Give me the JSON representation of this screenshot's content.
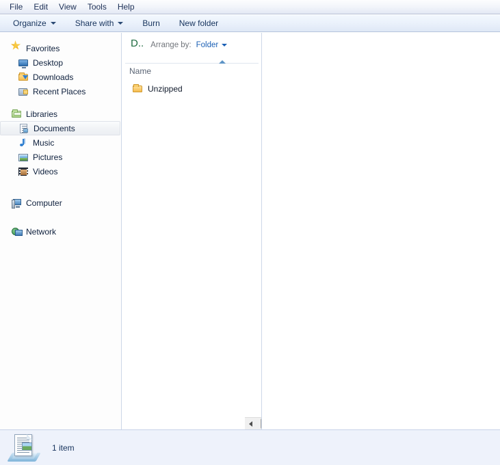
{
  "menubar": {
    "items": [
      {
        "label": "File",
        "name": "menu-file"
      },
      {
        "label": "Edit",
        "name": "menu-edit"
      },
      {
        "label": "View",
        "name": "menu-view"
      },
      {
        "label": "Tools",
        "name": "menu-tools"
      },
      {
        "label": "Help",
        "name": "menu-help"
      }
    ]
  },
  "toolbar": {
    "organize_label": "Organize",
    "share_with_label": "Share with",
    "burn_label": "Burn",
    "new_folder_label": "New folder"
  },
  "sidebar": {
    "groups": [
      {
        "label": "Favorites",
        "icon": "star-icon",
        "children": [
          {
            "label": "Desktop",
            "icon": "monitor-icon"
          },
          {
            "label": "Downloads",
            "icon": "downloads-folder-icon"
          },
          {
            "label": "Recent Places",
            "icon": "recent-places-icon"
          }
        ]
      },
      {
        "label": "Libraries",
        "icon": "libraries-icon",
        "children": [
          {
            "label": "Documents",
            "icon": "document-icon",
            "selected": true
          },
          {
            "label": "Music",
            "icon": "music-note-icon"
          },
          {
            "label": "Pictures",
            "icon": "picture-icon"
          },
          {
            "label": "Videos",
            "icon": "video-film-icon"
          }
        ]
      },
      {
        "label": "Computer",
        "icon": "computer-icon",
        "children": []
      },
      {
        "label": "Network",
        "icon": "network-icon",
        "children": []
      }
    ]
  },
  "filepane": {
    "library_title": "D..",
    "arrange_by_label": "Arrange by:",
    "arrange_by_value": "Folder",
    "column_header": "Name",
    "sort_direction": "ascending",
    "items": [
      {
        "name": "Unzipped",
        "icon": "folder-icon"
      }
    ]
  },
  "statusbar": {
    "item_count_text": "1 item",
    "icon": "documents-library-icon"
  },
  "colors": {
    "accent_blue": "#1b60b5",
    "library_title_green": "#1d6b3f",
    "folder_yellow": "#f5bc4e",
    "statusbar_bg": "#eef2fb",
    "text_dark": "#15325c"
  }
}
